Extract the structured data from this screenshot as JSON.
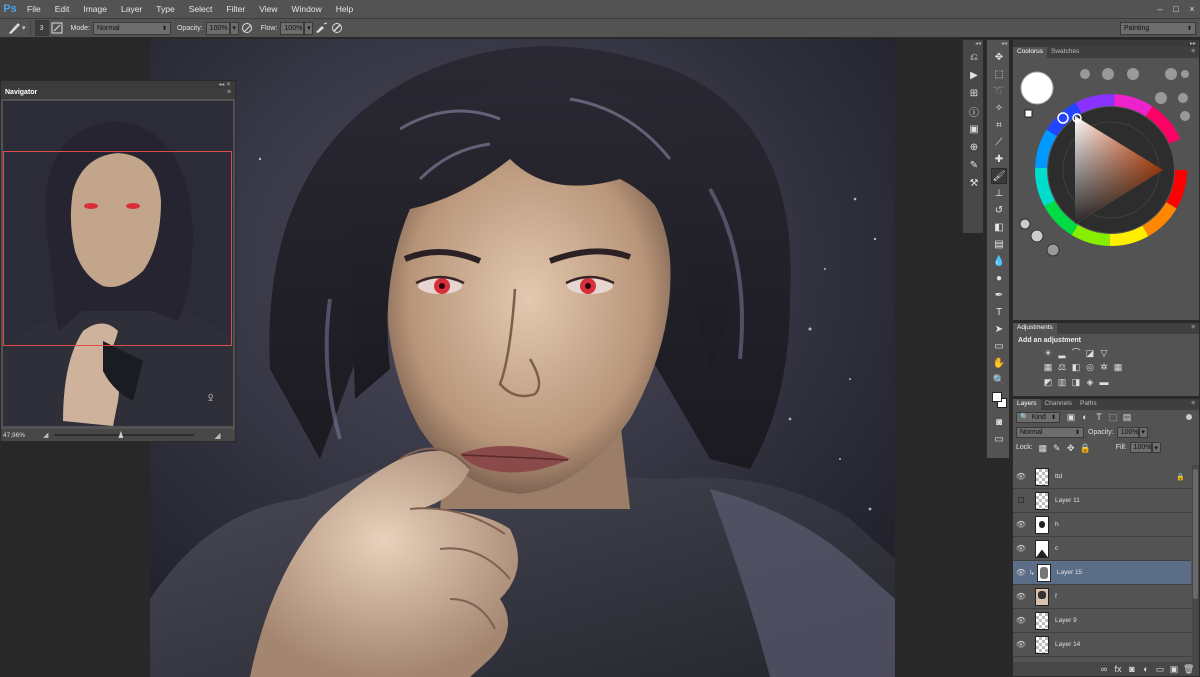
{
  "app": {
    "logo": "Ps"
  },
  "menu": [
    "File",
    "Edit",
    "Image",
    "Layer",
    "Type",
    "Select",
    "Filter",
    "View",
    "Window",
    "Help"
  ],
  "window_controls": [
    "–",
    "□",
    "×"
  ],
  "options": {
    "brush_size": "3",
    "mode_label": "Mode:",
    "mode_value": "Normal",
    "opacity_label": "Opacity:",
    "opacity_value": "100%",
    "flow_label": "Flow:",
    "flow_value": "100%",
    "workspace": "Painting"
  },
  "navigator": {
    "title": "Navigator",
    "zoom": "47,96%"
  },
  "color_panel": {
    "tabs": [
      "Coolorus",
      "Swatches"
    ]
  },
  "adjustments": {
    "title": "Adjustments",
    "hint": "Add an adjustment"
  },
  "layers_panel": {
    "tabs": [
      "Layers",
      "Channels",
      "Paths"
    ],
    "kind": "Kind",
    "blend_mode": "Normal",
    "opacity_label": "Opacity:",
    "opacity_value": "100%",
    "lock_label": "Lock:",
    "fill_label": "Fill:",
    "fill_value": "100%",
    "layers": [
      {
        "name": "ttd",
        "visible": true,
        "locked": true
      },
      {
        "name": "Layer 11",
        "visible": false
      },
      {
        "name": "h",
        "visible": true
      },
      {
        "name": "c",
        "visible": true
      },
      {
        "name": "Layer 15",
        "visible": true,
        "selected": true
      },
      {
        "name": "f",
        "visible": true
      },
      {
        "name": "Layer 9",
        "visible": true
      },
      {
        "name": "Layer 14",
        "visible": true
      }
    ]
  },
  "colors": {
    "ui_bg": "#535353",
    "dark_bg": "#282828",
    "selected_layer": "#5c6e87",
    "navigator_frame": "#e04a4a",
    "eye_red": "#d8303a"
  }
}
